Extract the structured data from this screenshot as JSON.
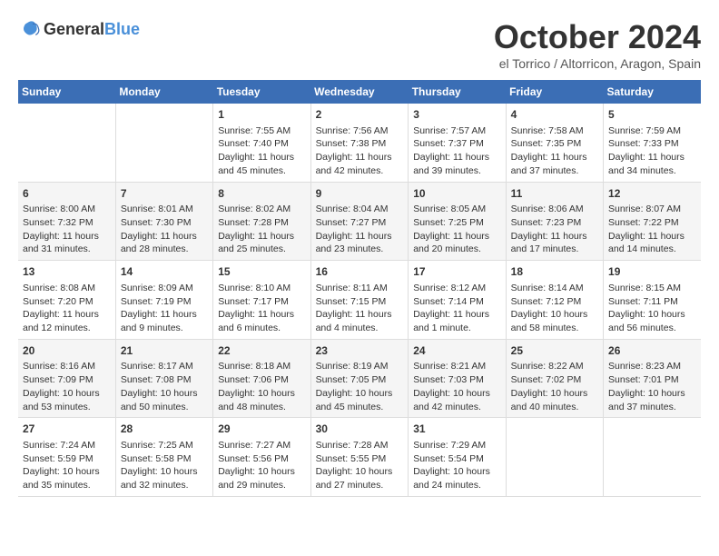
{
  "header": {
    "logo_general": "General",
    "logo_blue": "Blue",
    "month": "October 2024",
    "location": "el Torrico / Altorricon, Aragon, Spain"
  },
  "columns": [
    "Sunday",
    "Monday",
    "Tuesday",
    "Wednesday",
    "Thursday",
    "Friday",
    "Saturday"
  ],
  "weeks": [
    [
      {
        "day": "",
        "content": ""
      },
      {
        "day": "",
        "content": ""
      },
      {
        "day": "1",
        "content": "Sunrise: 7:55 AM\nSunset: 7:40 PM\nDaylight: 11 hours and 45 minutes."
      },
      {
        "day": "2",
        "content": "Sunrise: 7:56 AM\nSunset: 7:38 PM\nDaylight: 11 hours and 42 minutes."
      },
      {
        "day": "3",
        "content": "Sunrise: 7:57 AM\nSunset: 7:37 PM\nDaylight: 11 hours and 39 minutes."
      },
      {
        "day": "4",
        "content": "Sunrise: 7:58 AM\nSunset: 7:35 PM\nDaylight: 11 hours and 37 minutes."
      },
      {
        "day": "5",
        "content": "Sunrise: 7:59 AM\nSunset: 7:33 PM\nDaylight: 11 hours and 34 minutes."
      }
    ],
    [
      {
        "day": "6",
        "content": "Sunrise: 8:00 AM\nSunset: 7:32 PM\nDaylight: 11 hours and 31 minutes."
      },
      {
        "day": "7",
        "content": "Sunrise: 8:01 AM\nSunset: 7:30 PM\nDaylight: 11 hours and 28 minutes."
      },
      {
        "day": "8",
        "content": "Sunrise: 8:02 AM\nSunset: 7:28 PM\nDaylight: 11 hours and 25 minutes."
      },
      {
        "day": "9",
        "content": "Sunrise: 8:04 AM\nSunset: 7:27 PM\nDaylight: 11 hours and 23 minutes."
      },
      {
        "day": "10",
        "content": "Sunrise: 8:05 AM\nSunset: 7:25 PM\nDaylight: 11 hours and 20 minutes."
      },
      {
        "day": "11",
        "content": "Sunrise: 8:06 AM\nSunset: 7:23 PM\nDaylight: 11 hours and 17 minutes."
      },
      {
        "day": "12",
        "content": "Sunrise: 8:07 AM\nSunset: 7:22 PM\nDaylight: 11 hours and 14 minutes."
      }
    ],
    [
      {
        "day": "13",
        "content": "Sunrise: 8:08 AM\nSunset: 7:20 PM\nDaylight: 11 hours and 12 minutes."
      },
      {
        "day": "14",
        "content": "Sunrise: 8:09 AM\nSunset: 7:19 PM\nDaylight: 11 hours and 9 minutes."
      },
      {
        "day": "15",
        "content": "Sunrise: 8:10 AM\nSunset: 7:17 PM\nDaylight: 11 hours and 6 minutes."
      },
      {
        "day": "16",
        "content": "Sunrise: 8:11 AM\nSunset: 7:15 PM\nDaylight: 11 hours and 4 minutes."
      },
      {
        "day": "17",
        "content": "Sunrise: 8:12 AM\nSunset: 7:14 PM\nDaylight: 11 hours and 1 minute."
      },
      {
        "day": "18",
        "content": "Sunrise: 8:14 AM\nSunset: 7:12 PM\nDaylight: 10 hours and 58 minutes."
      },
      {
        "day": "19",
        "content": "Sunrise: 8:15 AM\nSunset: 7:11 PM\nDaylight: 10 hours and 56 minutes."
      }
    ],
    [
      {
        "day": "20",
        "content": "Sunrise: 8:16 AM\nSunset: 7:09 PM\nDaylight: 10 hours and 53 minutes."
      },
      {
        "day": "21",
        "content": "Sunrise: 8:17 AM\nSunset: 7:08 PM\nDaylight: 10 hours and 50 minutes."
      },
      {
        "day": "22",
        "content": "Sunrise: 8:18 AM\nSunset: 7:06 PM\nDaylight: 10 hours and 48 minutes."
      },
      {
        "day": "23",
        "content": "Sunrise: 8:19 AM\nSunset: 7:05 PM\nDaylight: 10 hours and 45 minutes."
      },
      {
        "day": "24",
        "content": "Sunrise: 8:21 AM\nSunset: 7:03 PM\nDaylight: 10 hours and 42 minutes."
      },
      {
        "day": "25",
        "content": "Sunrise: 8:22 AM\nSunset: 7:02 PM\nDaylight: 10 hours and 40 minutes."
      },
      {
        "day": "26",
        "content": "Sunrise: 8:23 AM\nSunset: 7:01 PM\nDaylight: 10 hours and 37 minutes."
      }
    ],
    [
      {
        "day": "27",
        "content": "Sunrise: 7:24 AM\nSunset: 5:59 PM\nDaylight: 10 hours and 35 minutes."
      },
      {
        "day": "28",
        "content": "Sunrise: 7:25 AM\nSunset: 5:58 PM\nDaylight: 10 hours and 32 minutes."
      },
      {
        "day": "29",
        "content": "Sunrise: 7:27 AM\nSunset: 5:56 PM\nDaylight: 10 hours and 29 minutes."
      },
      {
        "day": "30",
        "content": "Sunrise: 7:28 AM\nSunset: 5:55 PM\nDaylight: 10 hours and 27 minutes."
      },
      {
        "day": "31",
        "content": "Sunrise: 7:29 AM\nSunset: 5:54 PM\nDaylight: 10 hours and 24 minutes."
      },
      {
        "day": "",
        "content": ""
      },
      {
        "day": "",
        "content": ""
      }
    ]
  ]
}
